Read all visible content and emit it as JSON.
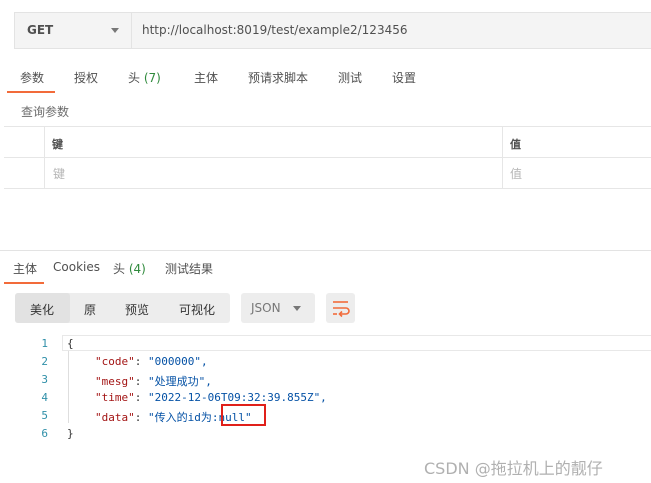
{
  "request": {
    "method": "GET",
    "url": "http://localhost:8019/test/example2/123456"
  },
  "request_tabs": [
    {
      "label": "参数",
      "count": ""
    },
    {
      "label": "授权",
      "count": ""
    },
    {
      "label": "头",
      "count": "(7)"
    },
    {
      "label": "主体",
      "count": ""
    },
    {
      "label": "预请求脚本",
      "count": ""
    },
    {
      "label": "测试",
      "count": ""
    },
    {
      "label": "设置",
      "count": ""
    }
  ],
  "params": {
    "title": "查询参数",
    "header_key": "键",
    "header_value": "值",
    "key_placeholder": "键",
    "value_placeholder": "值"
  },
  "response_tabs": [
    {
      "label": "主体",
      "count": ""
    },
    {
      "label": "Cookies",
      "count": ""
    },
    {
      "label": "头",
      "count": "(4)"
    },
    {
      "label": "测试结果",
      "count": ""
    }
  ],
  "view_modes": [
    "美化",
    "原",
    "预览",
    "可视化"
  ],
  "format": "JSON",
  "code": {
    "line_numbers": [
      "1",
      "2",
      "3",
      "4",
      "5",
      "6"
    ],
    "open_brace": "{",
    "close_brace": "}",
    "fields": [
      {
        "key": "\"code\"",
        "value": "\"000000\","
      },
      {
        "key": "\"mesg\"",
        "value": "\"处理成功\","
      },
      {
        "key": "\"time\"",
        "value": "\"2022-12-06T09:32:39.855Z\","
      },
      {
        "key": "\"data\"",
        "value_prefix": "\"传入的id为:",
        "value_highlight": "null\""
      }
    ]
  },
  "watermark": "CSDN @拖拉机上的靓仔",
  "colors": {
    "accent": "#f26b3a",
    "highlight_box": "#e0201a"
  }
}
